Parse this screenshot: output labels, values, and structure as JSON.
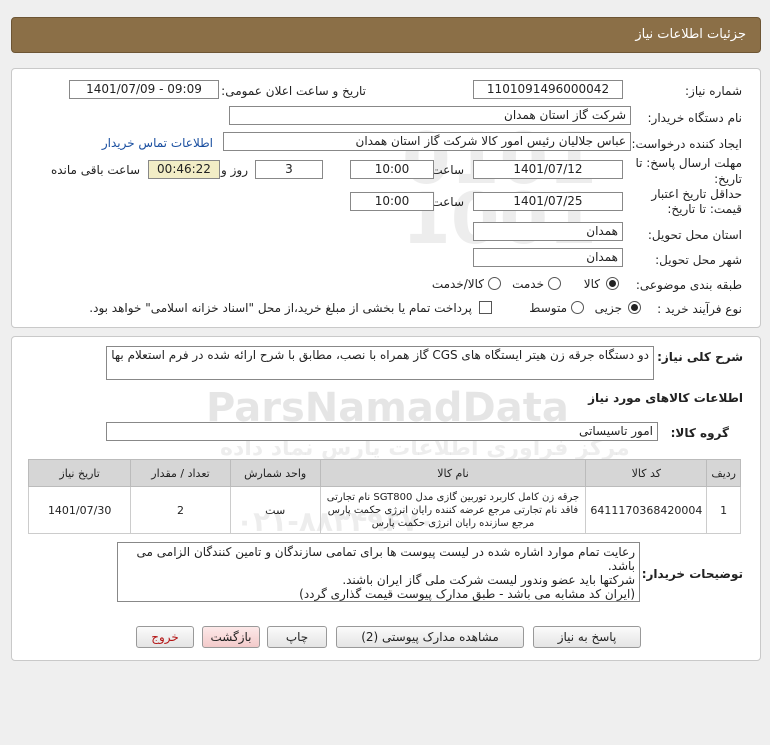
{
  "title": "جزئیات اطلاعات نیاز",
  "watermark": {
    "brand": "ParsNamadData",
    "line1": "مرکز فراوری اطلاعات پارس نماد داده",
    "phone": "۰۲۱-۸۸۳۴۹۶۷۰"
  },
  "fields": {
    "need_no_label": "شماره نیاز:",
    "need_no": "1101091496000042",
    "announce_label": "تاریخ و ساعت اعلان عمومی:",
    "announce_value": "1401/07/09 - 09:09",
    "buyer_label": "نام دستگاه خریدار:",
    "buyer_value": "شرکت گاز استان همدان",
    "creator_label": "ایجاد کننده درخواست:",
    "creator_value": "عباس جلالیان رئیس امور کالا شرکت گاز استان همدان",
    "contact_link": "اطلاعات تماس خریدار",
    "reply_label": "مهلت ارسال پاسخ: تا تاریخ:",
    "reply_date": "1401/07/12",
    "time_label": "ساعت",
    "reply_time": "10:00",
    "days_value": "3",
    "days_label": "روز و",
    "remain_value": "00:46:22",
    "remain_label": "ساعت باقی مانده",
    "valid_label_1": "حداقل تاریخ اعتبار",
    "valid_label_2": "قیمت: تا تاریخ:",
    "valid_date": "1401/07/25",
    "valid_time": "10:00",
    "province_label": "استان محل تحویل:",
    "province_value": "همدان",
    "city_label": "شهر محل تحویل:",
    "city_value": "همدان",
    "category_label": "طبقه بندی موضوعی:",
    "cat_goods": "کالا",
    "cat_service": "خدمت",
    "cat_both": "کالا/خدمت",
    "proc_label": "نوع فرآیند خرید :",
    "proc_partial": "جزیی",
    "proc_medium": "متوسط",
    "proc_note": "پرداخت تمام یا بخشی از مبلغ خرید،از محل \"اسناد خزانه اسلامی\" خواهد بود."
  },
  "desc_label": "شرح کلی نیاز:",
  "desc_value": "دو دستگاه جرقه زن هیتر ایستگاه های  CGS گاز همراه با نصب، مطابق با شرح ارائه شده در فرم استعلام بها",
  "goods_info_title": "اطلاعات کالاهای مورد نیاز",
  "group_label": "گروه کالا:",
  "group_value": "امور تاسیساتی",
  "table": {
    "headers": [
      "ردیف",
      "کد کالا",
      "نام کالا",
      "واحد شمارش",
      "تعداد / مقدار",
      "تاریخ نیاز"
    ],
    "rows": [
      {
        "row": "1",
        "code": "6411170368420004",
        "name": "جرقه زن کامل کاربرد توربین گازی مدل SGT800 نام تجارتی فاقد نام تجارتی مرجع عرضه کننده رایان انرژی حکمت پارس مرجع سازنده رایان انرژی حکمت پارس",
        "unit": "ست",
        "qty": "2",
        "date": "1401/07/30"
      }
    ]
  },
  "notes_label": "توضیحات خریدار:",
  "notes": [
    "رعایت تمام موارد اشاره شده در لیست پیوست ها برای تمامی سازندگان و تامین کنندگان الزامی می باشد.",
    "شرکتها باید عضو وندور لیست شرکت ملی گاز  ایران باشند.",
    "(ایران کد مشابه می باشد - طبق مدارک پیوست قیمت گذاری گردد)"
  ],
  "buttons": {
    "reply": "پاسخ به نیاز",
    "docs": "مشاهده مدارک پیوستی (2)",
    "print": "چاپ",
    "back": "بازگشت",
    "exit": "خروج"
  }
}
